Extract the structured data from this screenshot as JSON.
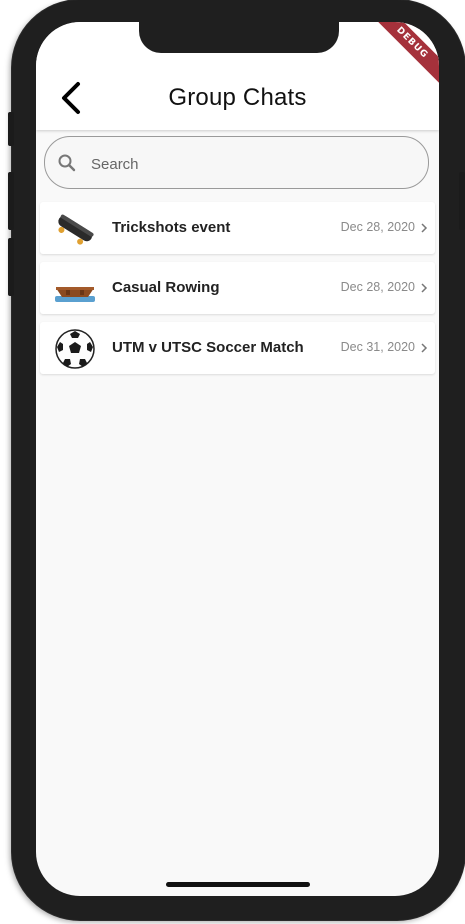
{
  "header": {
    "title": "Group Chats",
    "debug_label": "DEBUG"
  },
  "search": {
    "placeholder": "Search",
    "value": ""
  },
  "chats": [
    {
      "title": "Trickshots event",
      "date": "Dec 28, 2020",
      "icon": "skateboard-icon"
    },
    {
      "title": "Casual Rowing",
      "date": "Dec 28, 2020",
      "icon": "rowboat-icon"
    },
    {
      "title": "UTM v UTSC Soccer Match",
      "date": "Dec 31, 2020",
      "icon": "soccer-ball-icon"
    }
  ],
  "colors": {
    "debug_ribbon": "#a5313b",
    "screen_background": "#f9f9f9",
    "row_background": "#ffffff"
  }
}
